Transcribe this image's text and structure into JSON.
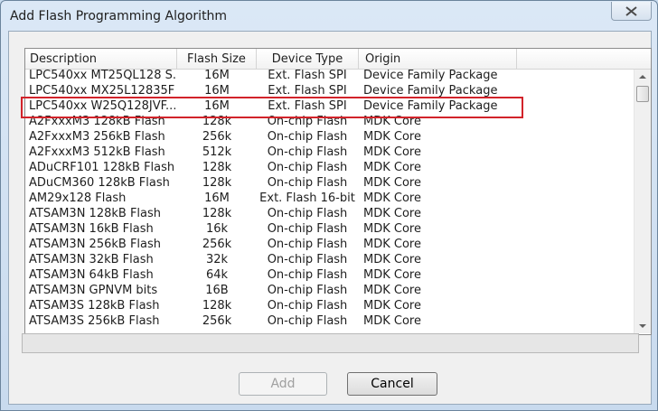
{
  "dialog": {
    "title": "Add Flash Programming Algorithm"
  },
  "table": {
    "columns": [
      "Description",
      "Flash Size",
      "Device Type",
      "Origin"
    ],
    "rows": [
      {
        "description": "LPC540xx MT25QL128 S...",
        "size": "16M",
        "type": "Ext. Flash SPI",
        "origin": "Device Family Package"
      },
      {
        "description": "LPC540xx MX25L12835F",
        "size": "16M",
        "type": "Ext. Flash SPI",
        "origin": "Device Family Package"
      },
      {
        "description": "LPC540xx W25Q128JVF...",
        "size": "16M",
        "type": "Ext. Flash SPI",
        "origin": "Device Family Package"
      },
      {
        "description": "A2FxxxM3 128kB Flash",
        "size": "128k",
        "type": "On-chip Flash",
        "origin": "MDK Core"
      },
      {
        "description": "A2FxxxM3 256kB Flash",
        "size": "256k",
        "type": "On-chip Flash",
        "origin": "MDK Core"
      },
      {
        "description": "A2FxxxM3 512kB Flash",
        "size": "512k",
        "type": "On-chip Flash",
        "origin": "MDK Core"
      },
      {
        "description": "ADuCRF101 128kB Flash",
        "size": "128k",
        "type": "On-chip Flash",
        "origin": "MDK Core"
      },
      {
        "description": "ADuCM360 128kB Flash",
        "size": "128k",
        "type": "On-chip Flash",
        "origin": "MDK Core"
      },
      {
        "description": "AM29x128 Flash",
        "size": "16M",
        "type": "Ext. Flash 16-bit",
        "origin": "MDK Core"
      },
      {
        "description": "ATSAM3N 128kB Flash",
        "size": "128k",
        "type": "On-chip Flash",
        "origin": "MDK Core"
      },
      {
        "description": "ATSAM3N 16kB Flash",
        "size": "16k",
        "type": "On-chip Flash",
        "origin": "MDK Core"
      },
      {
        "description": "ATSAM3N 256kB Flash",
        "size": "256k",
        "type": "On-chip Flash",
        "origin": "MDK Core"
      },
      {
        "description": "ATSAM3N 32kB Flash",
        "size": "32k",
        "type": "On-chip Flash",
        "origin": "MDK Core"
      },
      {
        "description": "ATSAM3N 64kB Flash",
        "size": "64k",
        "type": "On-chip Flash",
        "origin": "MDK Core"
      },
      {
        "description": "ATSAM3N GPNVM bits",
        "size": "16B",
        "type": "On-chip Flash",
        "origin": "MDK Core"
      },
      {
        "description": "ATSAM3S 128kB Flash",
        "size": "128k",
        "type": "On-chip Flash",
        "origin": "MDK Core"
      },
      {
        "description": "ATSAM3S 256kB Flash",
        "size": "256k",
        "type": "On-chip Flash",
        "origin": "MDK Core"
      }
    ],
    "highlighted_row": 2,
    "highlight_color": "#d2232a"
  },
  "buttons": {
    "add": "Add",
    "cancel": "Cancel"
  },
  "icons": {
    "close": "close-icon",
    "scroll_up": "scroll-up-arrow-icon",
    "scroll_down": "scroll-down-arrow-icon"
  }
}
